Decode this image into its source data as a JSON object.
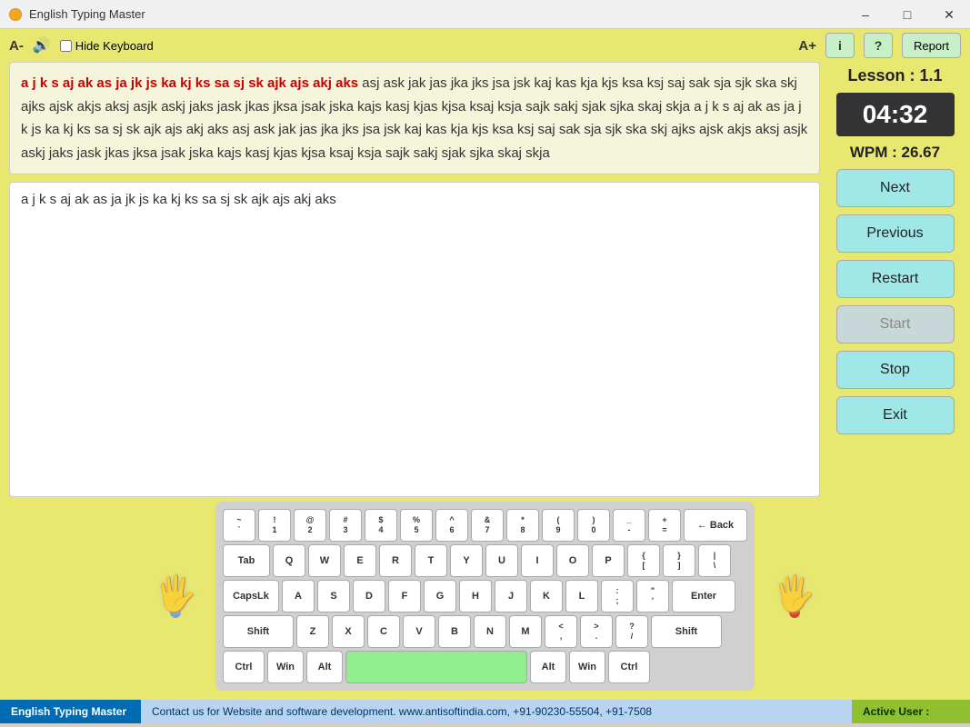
{
  "window": {
    "title": "English Typing Master",
    "traffic_light_color": "#f5a623"
  },
  "header": {
    "font_minus": "A-",
    "font_plus": "A+",
    "hide_keyboard_label": "Hide Keyboard",
    "info_label": "i",
    "help_label": "?",
    "report_label": "Report"
  },
  "lesson": {
    "label": "Lesson : 1.1",
    "timer": "04:32",
    "wpm_label": "WPM : 26.67"
  },
  "text_display": {
    "typed_text": "a j k s aj ak as ja jk js ka kj ks sa sj sk ajk ajs akj aks",
    "remaining_text": " asj ask jak jas jka jks jsa jsk kaj kas kja kjs ksa ksj saj sak sja sjk ska skj ajks ajsk akjs aksj asjk askj jaks jask jkas jksa jsak jska kajs kasj kjas kjsa ksaj ksja sajk sakj sjak sjka skaj skja a j k s aj ak as ja jk js ka kj ks sa sj sk ajk ajs akj aks asj ask jak jas jka jks jsa jsk kaj kas kja kjs ksa ksj saj sak sja sjk ska skj ajks ajsk akjs aksj asjk askj jaks jask jkas jksa jsak jska kajs kasj kjas kjsa ksaj ksja sajk sakj sjak sjka skaj skja"
  },
  "typing_input": {
    "current_text": "a j k s aj ak as ja jk js ka kj ks sa sj sk ajk ajs akj aks",
    "placeholder": ""
  },
  "buttons": {
    "next": "Next",
    "previous": "Previous",
    "restart": "Restart",
    "start": "Start",
    "stop": "Stop",
    "exit": "Exit"
  },
  "keyboard": {
    "rows": [
      [
        "~\n`",
        "!\n1",
        "@\n2",
        "#\n3",
        "$\n4",
        "%\n5",
        "^\n6",
        "&\n7",
        "*\n8",
        "(\n9",
        ")\n0",
        "_\n-",
        "+\n=",
        "← Back"
      ],
      [
        "Tab",
        "Q",
        "W",
        "E",
        "R",
        "T",
        "Y",
        "U",
        "I",
        "O",
        "P",
        "{\n[",
        "}\n]",
        "|\n\\"
      ],
      [
        "CapsLk",
        "A",
        "S",
        "D",
        "F",
        "G",
        "H",
        "J",
        "K",
        "L",
        ":\n;",
        "\"\n'",
        "Enter"
      ],
      [
        "Shift",
        "Z",
        "X",
        "C",
        "V",
        "B",
        "N",
        "M",
        "<\n,",
        ">\n.",
        "?\n/",
        "Shift"
      ],
      [
        "Ctrl",
        "Win",
        "Alt",
        "",
        "Alt",
        "Win",
        "Ctrl"
      ]
    ]
  },
  "status_bar": {
    "app_name": "English Typing Master",
    "contact": "Contact us for Website and software development. www.antisoftindia.com, +91-90230-55504, +91-7508",
    "active_user_label": "Active User :"
  }
}
